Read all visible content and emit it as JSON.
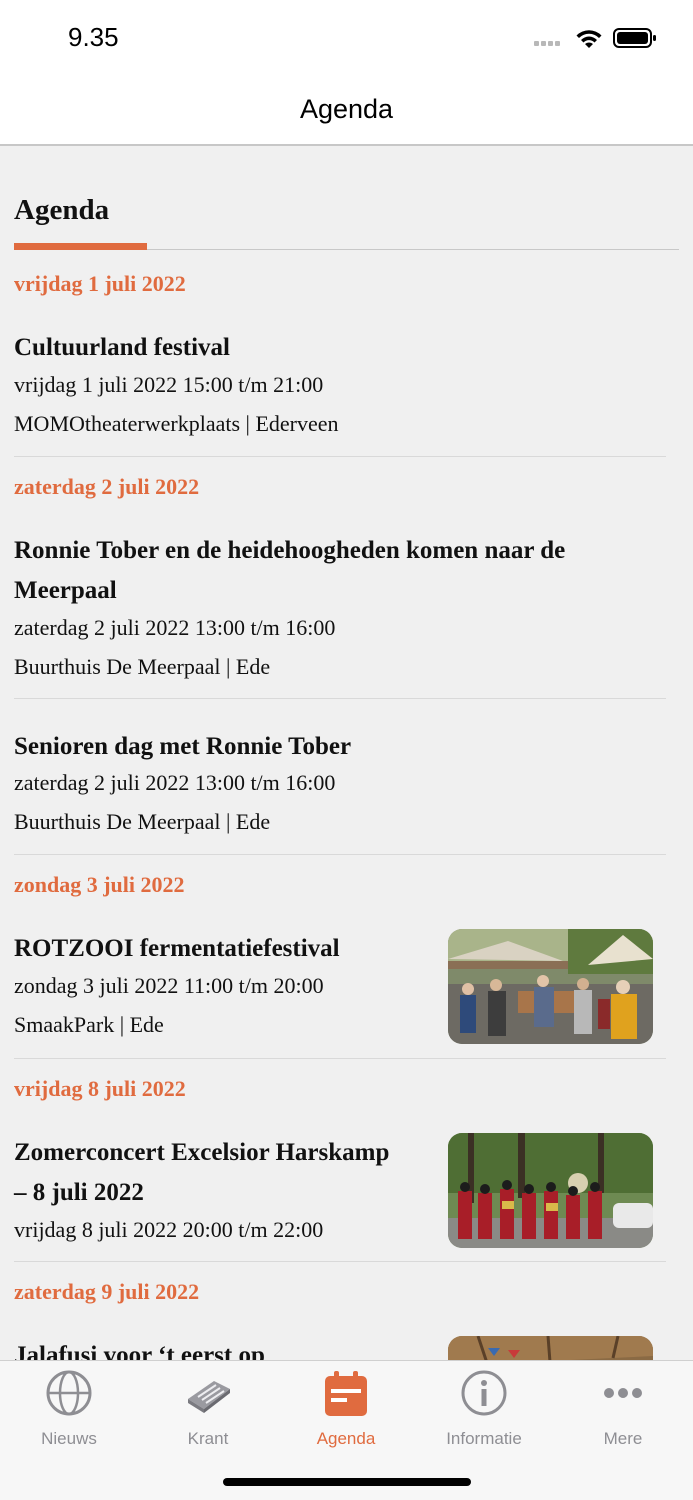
{
  "status_bar": {
    "time": "9.35"
  },
  "nav": {
    "title": "Agenda"
  },
  "section": {
    "heading": "Agenda"
  },
  "days": [
    {
      "date": "vrijdag 1 juli 2022"
    },
    {
      "date": "zaterdag 2 juli 2022"
    },
    {
      "date": "zondag 3 juli 2022"
    },
    {
      "date": "vrijdag 8 juli 2022"
    },
    {
      "date": "zaterdag 9 juli 2022"
    }
  ],
  "events": [
    {
      "title": "Cultuurland festival",
      "time": "vrijdag 1 juli 2022 15:00 t/m 21:00",
      "location": "MOMOtheaterwerkplaats | Ederveen"
    },
    {
      "title_line1": "Ronnie Tober en de heidehoogheden komen naar de",
      "title_line2": "Meerpaal",
      "time": "zaterdag 2 juli 2022 13:00 t/m 16:00",
      "location": "Buurthuis De Meerpaal | Ede"
    },
    {
      "title": "Senioren dag met Ronnie Tober",
      "time": "zaterdag 2 juli 2022 13:00 t/m 16:00",
      "location": "Buurthuis De Meerpaal | Ede"
    },
    {
      "title": "ROTZOOI fermentatiefestival",
      "time": "zondag 3 juli 2022 11:00 t/m 20:00",
      "location": "SmaakPark | Ede"
    },
    {
      "title_line1": "Zomerconcert Excelsior Harskamp",
      "title_line2": "– 8 juli 2022",
      "time": "vrijdag 8 juli 2022 20:00 t/m 22:00"
    },
    {
      "title": "Jalafusi voor ‘t eerst op"
    }
  ],
  "tabs": [
    {
      "label": "Nieuws",
      "icon": "globe-icon"
    },
    {
      "label": "Krant",
      "icon": "newspaper-icon"
    },
    {
      "label": "Agenda",
      "icon": "calendar-icon"
    },
    {
      "label": "Informatie",
      "icon": "info-icon"
    },
    {
      "label": "Mere",
      "icon": "more-icon"
    }
  ],
  "colors": {
    "accent": "#e06b3f",
    "inactive": "#8e8e93"
  }
}
